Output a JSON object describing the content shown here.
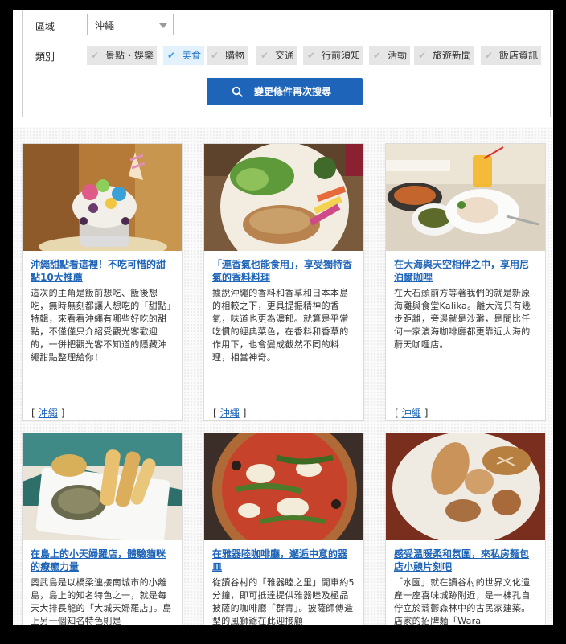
{
  "search": {
    "region_label": "區域",
    "region_value": "沖繩",
    "category_label": "類別",
    "categories": [
      {
        "label": "景點・娛樂",
        "active": false
      },
      {
        "label": "美食",
        "active": true
      },
      {
        "label": "購物",
        "active": false
      },
      {
        "label": "交通",
        "active": false
      },
      {
        "label": "行前須知",
        "active": false
      },
      {
        "label": "活動",
        "active": false
      },
      {
        "label": "旅遊新聞",
        "active": false
      },
      {
        "label": "飯店資訊",
        "active": false
      }
    ],
    "button_label": "變更條件再次搜尋"
  },
  "articles": [
    {
      "title": "沖繩甜點看這裡！不吃可惜的甜點10大推薦",
      "desc": "這次的主角是飯前想吃、飯後想吃，無時無刻都讓人想吃的「甜點」特輯，來看看沖繩有哪些好吃的甜點，不僅僅只介紹受觀光客歡迎的，一併把觀光客不知道的隱藏沖繩甜點整理給你！",
      "tag": "沖繩"
    },
    {
      "title": "「連香氣也能食用」，享受獨特香氣的香料料理",
      "desc": "據說沖繩的香料和香草和日本本島的相較之下，更具提振精神的香氣，味道也更為濃郁。就算是平常吃慣的經典菜色，在香料和香草的作用下，也會變成截然不同的料理，相當神奇。",
      "tag": "沖繩"
    },
    {
      "title": "在大海與天空相伴之中，享用尼泊爾咖哩",
      "desc": "在大石頭前方等著我們的就是新原海灘與食堂Kalika。離大海只有幾步距離，旁邊就是沙灘，是間比任何一家濱海咖啡廳都更靠近大海的蔚天咖哩店。",
      "tag": "沖繩"
    },
    {
      "title": "在島上的小天婦羅店，體驗貓咪的療癒力量",
      "desc": "奧武島是以橋梁連接南城市的小離島，島上的知名特色之一，就是每天大排長龍的「大城天婦羅店」。島上另一個知名特色則是"
    },
    {
      "title": "在雅器睦咖啡廳，邂逅中意的器皿",
      "desc": "從讀谷村的「雅器睦之里」開車約5分鐘，即可抵達提供雅器睦及極品披薩的咖啡廳「群青」。披薩師傅造型的風獅爺在此迎接顧"
    },
    {
      "title": "感受溫暖柔和氛圍，來私房麵包店小憩片刻吧",
      "desc": "「水園」就在讀谷村的世界文化遺產一座喜味城跡附近，是一棟孔自佇立於蓊鬱森林中的古民家建築。店家的招牌麵「Wara"
    }
  ]
}
